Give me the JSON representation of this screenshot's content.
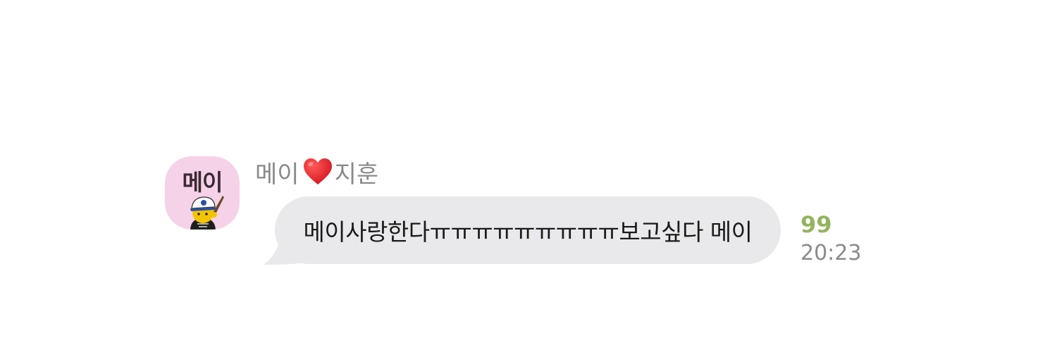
{
  "message": {
    "avatar": {
      "label": "메이",
      "background_color": "#f6d2e8",
      "icon": "character-with-cap-icon"
    },
    "sender": {
      "name_left": "메이",
      "heart_icon": "red-heart-icon",
      "name_right": "지훈"
    },
    "text": "메이사랑한다ㅠㅠㅠㅠㅠㅠㅠㅠㅠ보고싶다 메이",
    "bubble_color": "#e9e9eb",
    "unread_count": "99",
    "unread_color": "#93b45f",
    "time": "20:23"
  }
}
